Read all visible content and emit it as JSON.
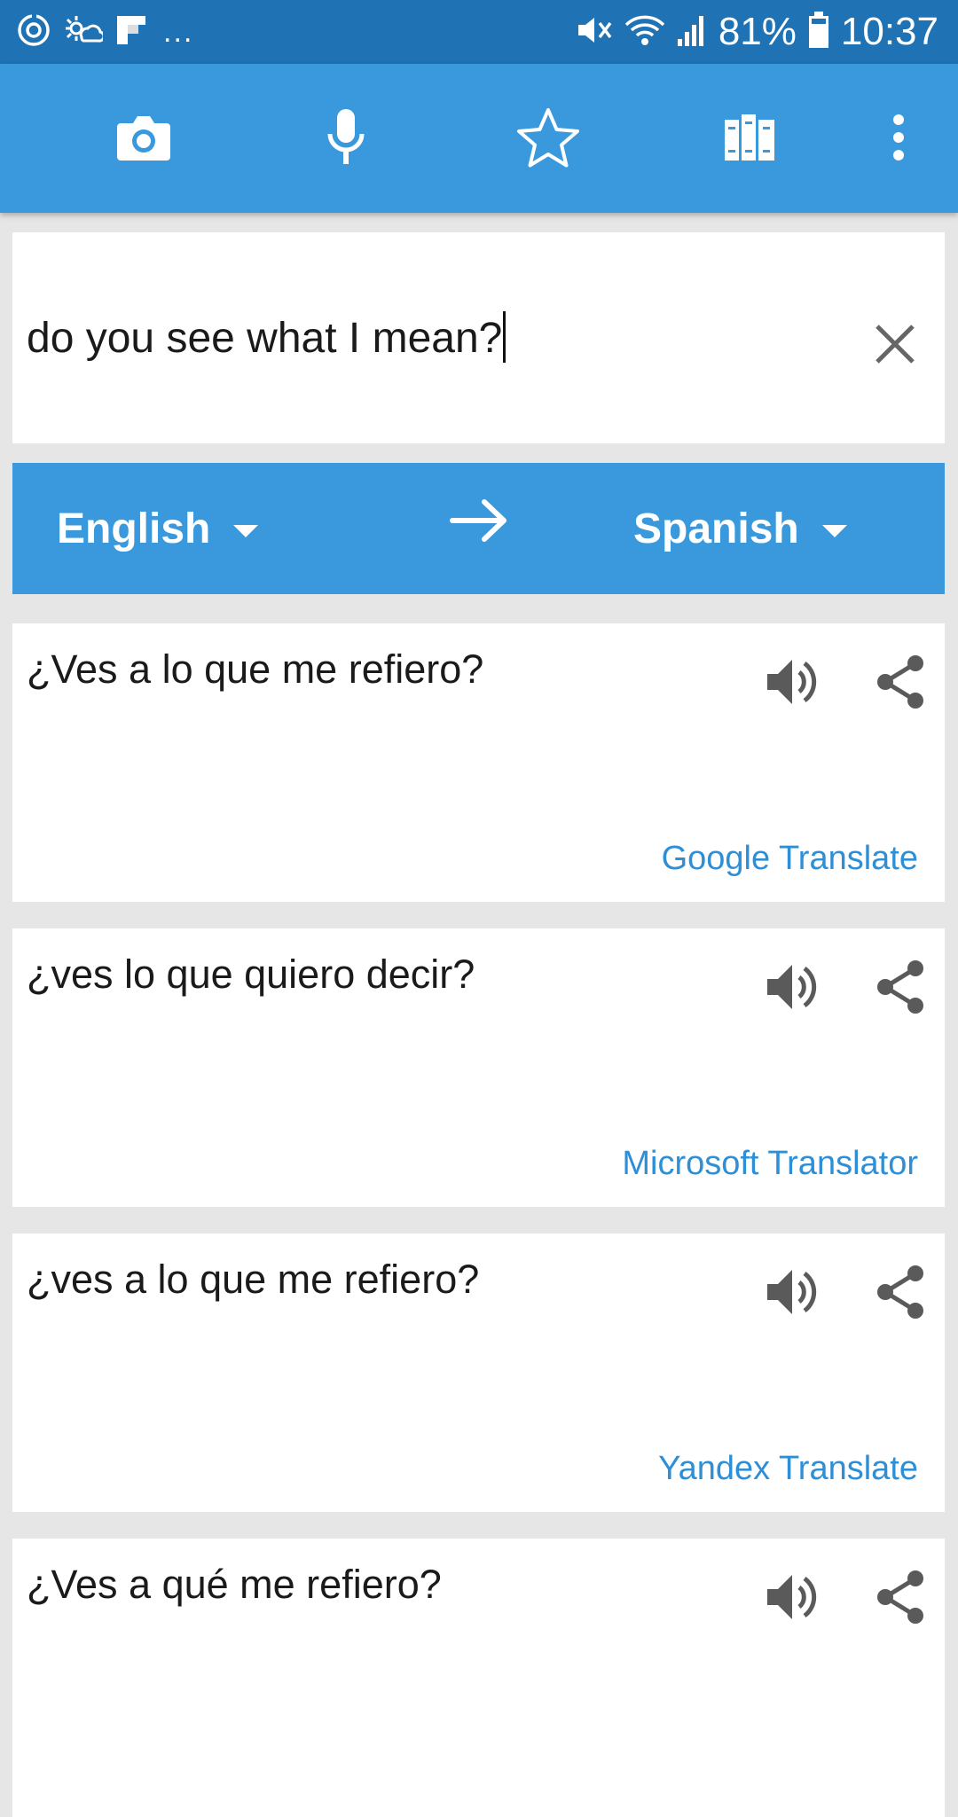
{
  "status_bar": {
    "overflow_dots": "...",
    "battery_percent": "81%",
    "time": "10:37"
  },
  "toolbar": {
    "icons": [
      "camera-icon",
      "microphone-icon",
      "star-icon",
      "books-icon",
      "more-vert-icon"
    ]
  },
  "input": {
    "text": "do you see what I mean?"
  },
  "languages": {
    "source": "English",
    "target": "Spanish"
  },
  "results": [
    {
      "text": "¿Ves a lo que me refiero?",
      "provider": "Google Translate"
    },
    {
      "text": "¿ves lo que quiero decir?",
      "provider": "Microsoft Translator"
    },
    {
      "text": "¿ves a lo que me refiero?",
      "provider": "Yandex Translate"
    },
    {
      "text": "¿Ves a qué me refiero?",
      "provider": ""
    }
  ],
  "colors": {
    "status_bar": "#1f72b3",
    "primary": "#3a99dc",
    "provider_link": "#2e8fd6",
    "background": "#e6e6e6"
  }
}
